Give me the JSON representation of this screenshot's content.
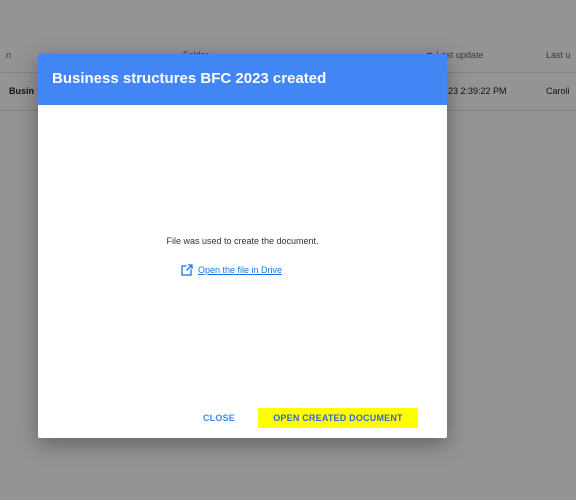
{
  "background_table": {
    "headers": {
      "col_left": "n",
      "folder": "Folder",
      "last_update": "▼ Last update",
      "last_u": "Last u"
    },
    "row": {
      "name": "Busin",
      "date": "23 2:39:22 PM",
      "user": "Caroli"
    }
  },
  "dialog": {
    "title": "Business structures BFC 2023 created",
    "message": "File was used to create the document.",
    "drive_link": {
      "label": "Open the file in Drive",
      "icon": "open-in-new-icon"
    },
    "buttons": {
      "close": "CLOSE",
      "open_document": "OPEN CREATED DOCUMENT"
    }
  },
  "colors": {
    "header_blue": "#4285f4",
    "highlight_yellow": "#ffff00",
    "link_blue": "#1a73e8"
  }
}
